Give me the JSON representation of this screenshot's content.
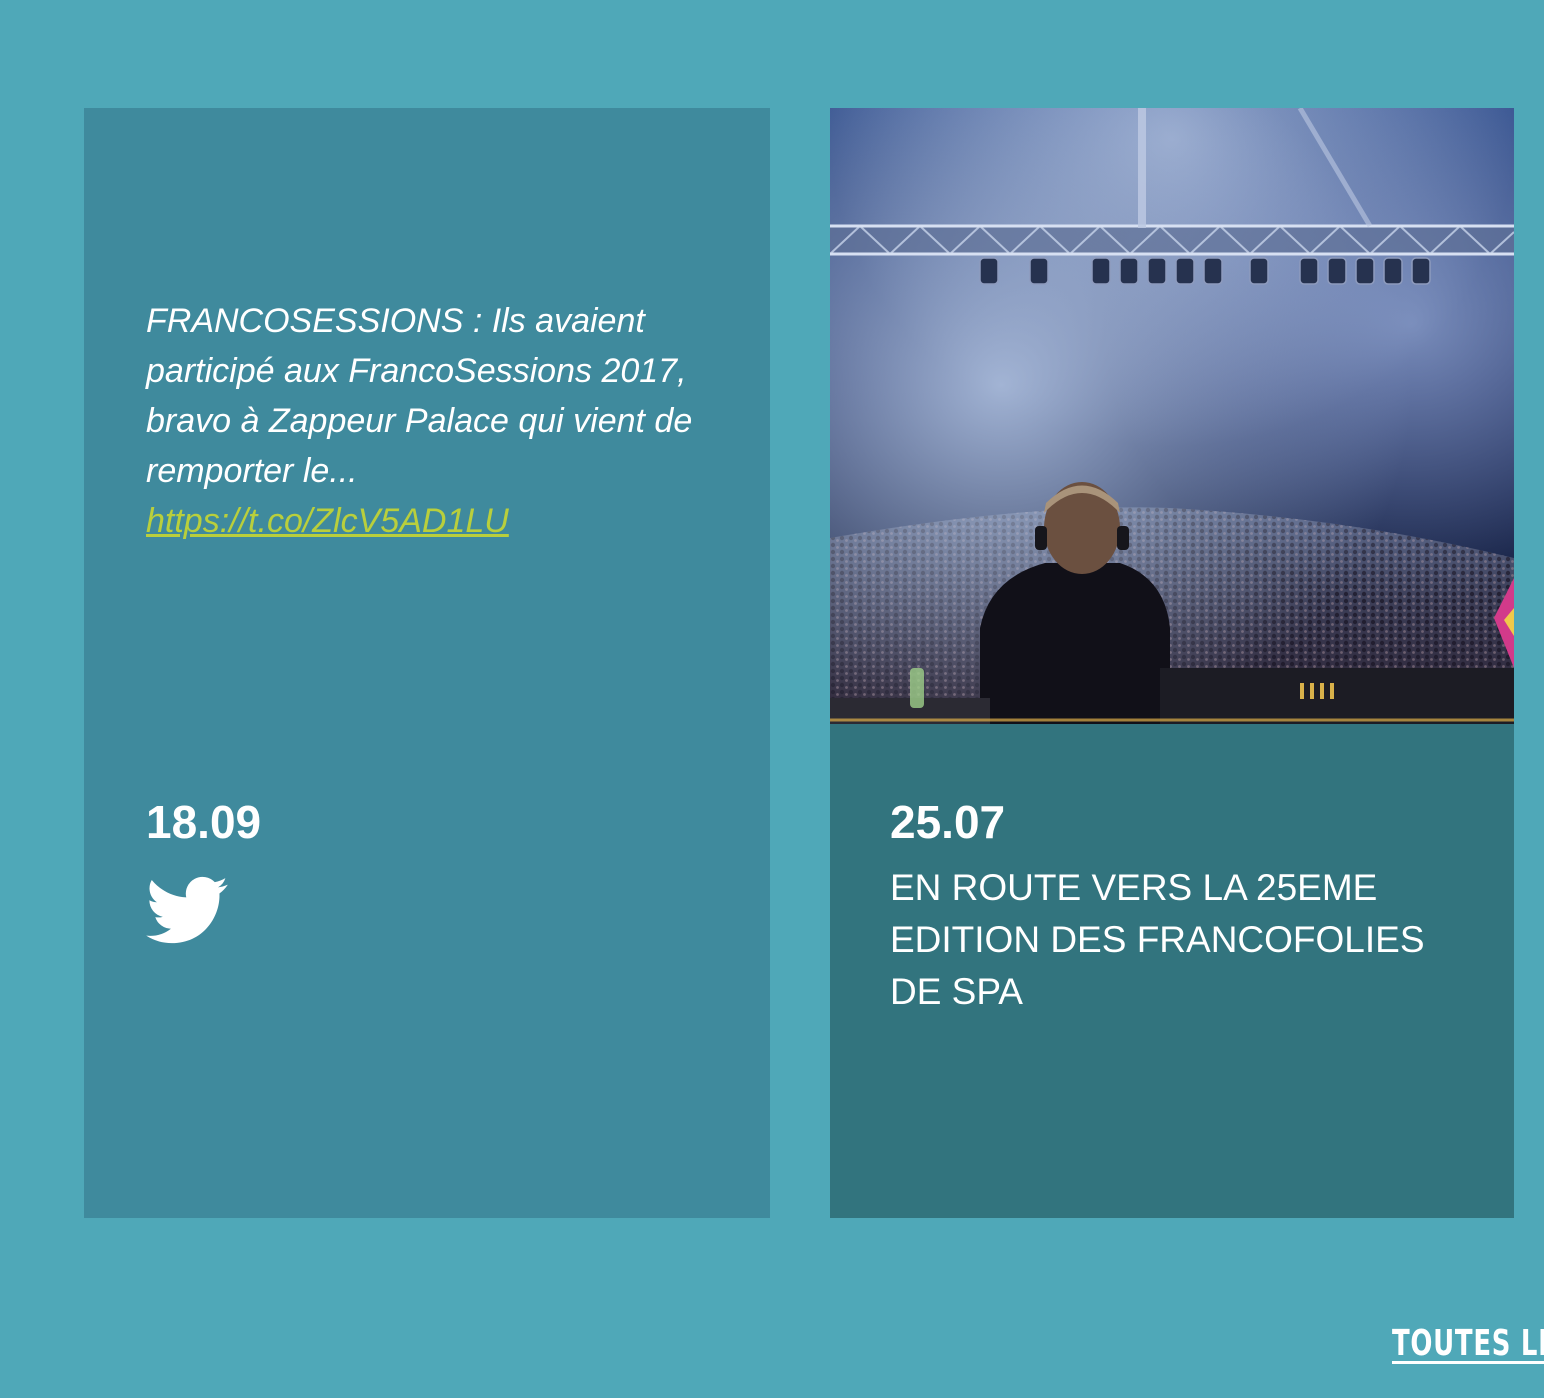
{
  "tweet_card": {
    "text": "FRANCOSESSIONS : Ils avaient participé aux FrancoSessions 2017, bravo à Zappeur Palace qui vient de remporter le...",
    "link": "https://t.co/ZlcV5AD1LU",
    "date": "18.09",
    "icon": "twitter-bird-icon"
  },
  "news_card": {
    "image": "concert-dj-crowd-photo",
    "date": "25.07",
    "title": "EN ROUTE VERS LA 25EME EDITION DES FRANCOFOLIES DE SPA"
  },
  "footer": {
    "all_link_label": "TOUTES LES"
  },
  "colors": {
    "page_bg": "#4fa8b8",
    "tweet_card_bg": "#3f8a9d",
    "news_card_bg": "#32747e",
    "link": "#b9cf3c",
    "text": "#ffffff"
  }
}
